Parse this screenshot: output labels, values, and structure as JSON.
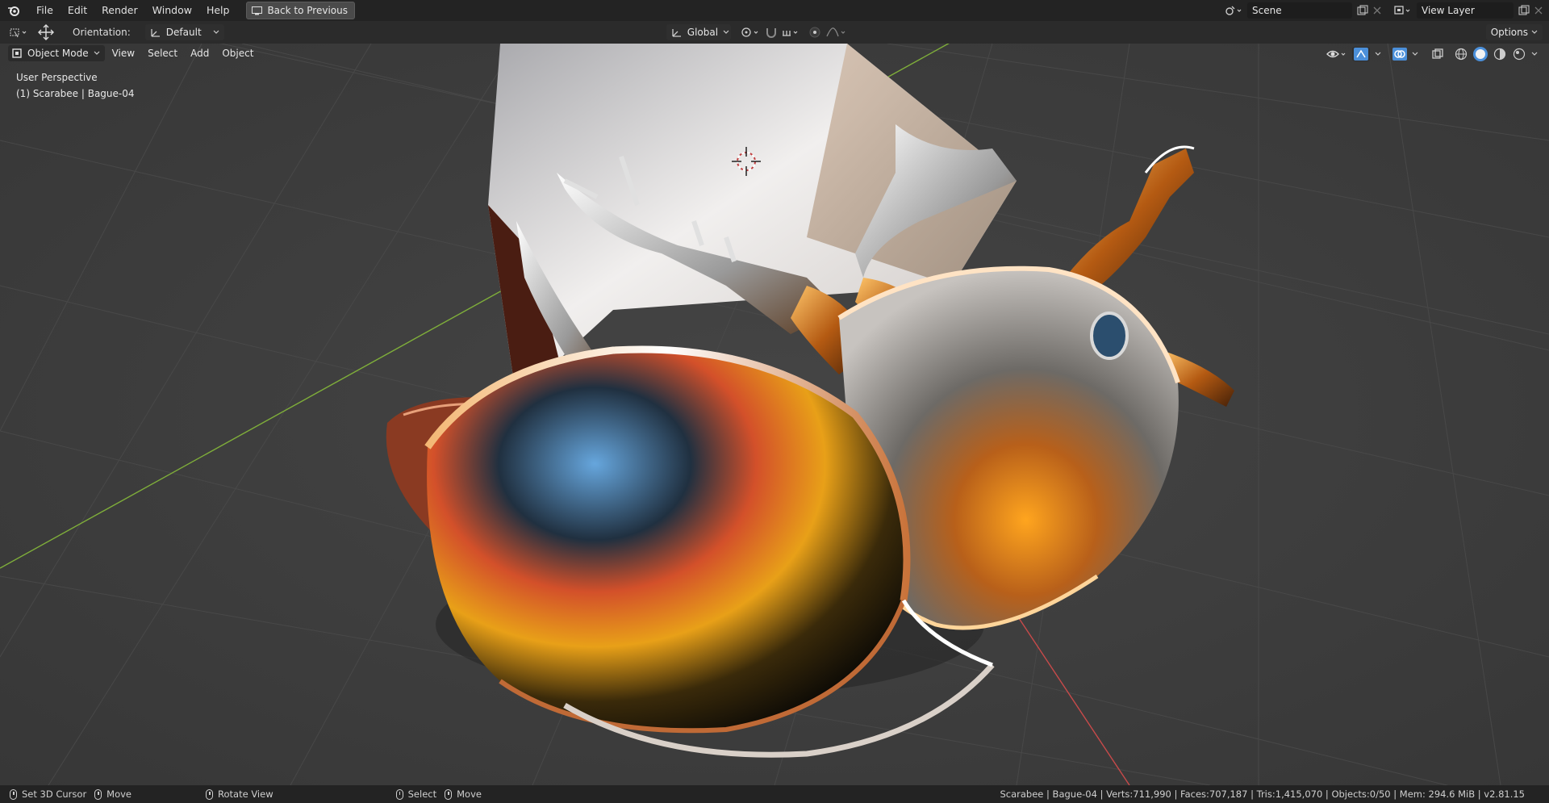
{
  "topbar": {
    "menu": [
      "File",
      "Edit",
      "Render",
      "Window",
      "Help"
    ],
    "back_label": "Back to Previous",
    "scene_name": "Scene",
    "view_layer_name": "View Layer"
  },
  "toolbar": {
    "orientation_label": "Orientation:",
    "orientation_value": "Default",
    "transform_space": "Global",
    "options_label": "Options"
  },
  "viewport_header": {
    "mode": "Object Mode",
    "menu": [
      "View",
      "Select",
      "Add",
      "Object"
    ]
  },
  "viewport": {
    "perspective_label": "User Perspective",
    "object_label": "(1) Scarabee | Bague-04"
  },
  "statusbar": {
    "left_action": "Set 3D Cursor",
    "middle_action": "Move",
    "rotate_action": "Rotate View",
    "select_action": "Select",
    "move_action": "Move",
    "stats": "Scarabee | Bague-04 | Verts:711,990 | Faces:707,187 | Tris:1,415,070 | Objects:0/50 | Mem: 294.6 MiB | v2.81.15"
  },
  "colors": {
    "background": "#3d3d3d",
    "topbar": "#232323",
    "toolbar": "#2b2b2b",
    "x_axis": "#c84a4a",
    "y_axis": "#7fae3a",
    "accent_blue": "#4b8fd9"
  }
}
